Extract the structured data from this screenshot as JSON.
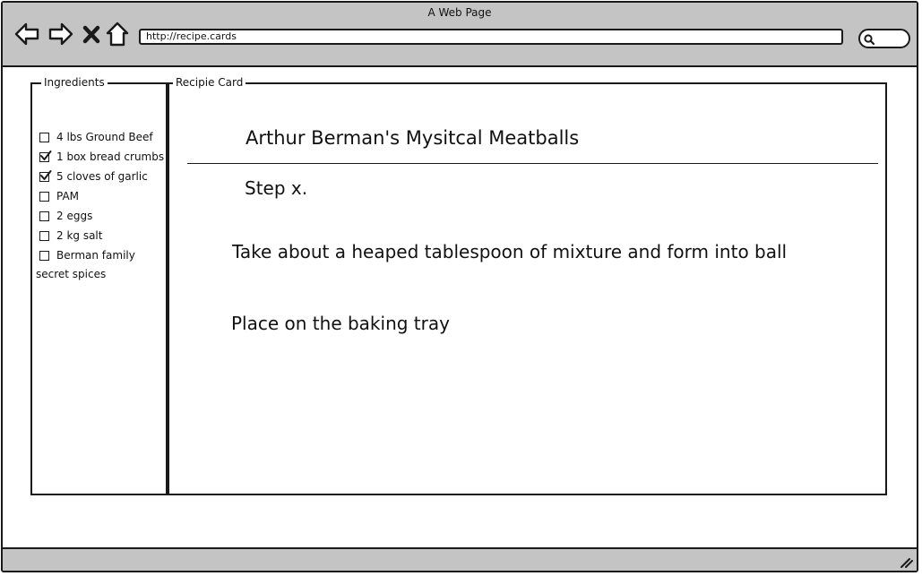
{
  "window": {
    "title": "A Web Page"
  },
  "toolbar": {
    "back_icon": "back-arrow-icon",
    "forward_icon": "forward-arrow-icon",
    "stop_icon": "close-icon",
    "home_icon": "home-icon",
    "url": "http://recipe.cards",
    "search_icon": "search-icon"
  },
  "ingredients": {
    "legend": "Ingredients",
    "items": [
      {
        "label": "4 lbs Ground Beef",
        "checked": false
      },
      {
        "label": "1 box bread crumbs",
        "checked": true
      },
      {
        "label": "5 cloves of garlic",
        "checked": true
      },
      {
        "label": "PAM",
        "checked": false
      },
      {
        "label": "2 eggs",
        "checked": false
      },
      {
        "label": "2 kg salt",
        "checked": false
      },
      {
        "label": "Berman family",
        "label_line2": "secret spices",
        "checked": false
      }
    ]
  },
  "recipe": {
    "legend": "Recipie Card",
    "title": "Arthur Berman's Mysitcal Meatballs",
    "step_heading": "Step x.",
    "instructions": [
      "Take about a heaped tablespoon of mixture and form into ball",
      "Place on the baking tray"
    ]
  },
  "colors": {
    "chrome": "#c4c4c4",
    "ink": "#1a1a1a",
    "background": "#ffffff"
  }
}
